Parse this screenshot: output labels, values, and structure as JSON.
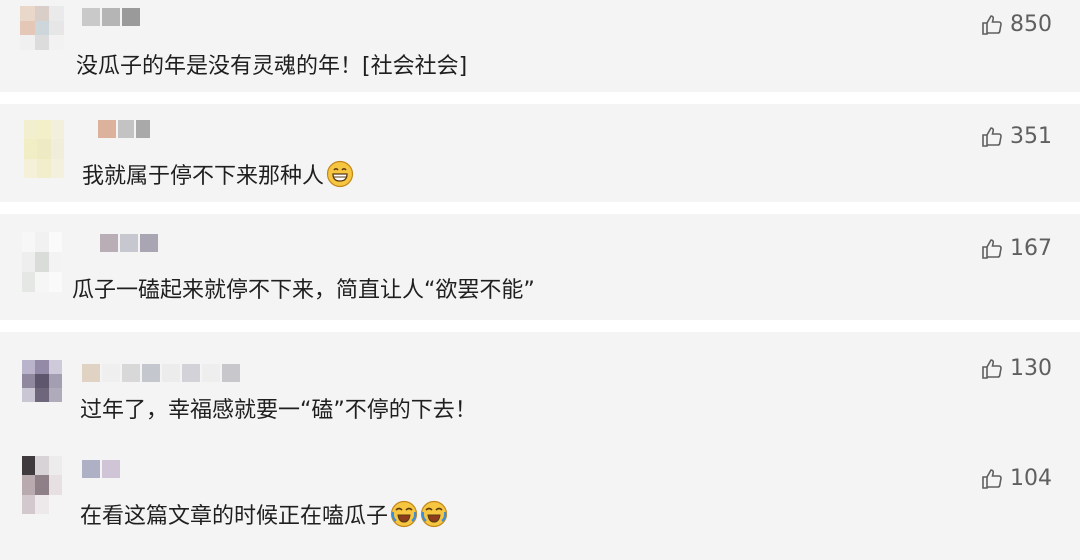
{
  "comments": [
    {
      "likes": "850",
      "text": "没瓜子的年是没有灵魂的年！[社会社会]",
      "emoji": ""
    },
    {
      "likes": "351",
      "text": "我就属于停不下来那种人",
      "emoji": "grin-emoji"
    },
    {
      "likes": "167",
      "text": "瓜子一磕起来就停不下来，简直让人“欲罢不能”",
      "emoji": ""
    },
    {
      "likes": "130",
      "text": "过年了，幸福感就要一“磕”不停的下去！",
      "emoji": ""
    },
    {
      "likes": "104",
      "text": "在看这篇文章的时候正在嗑瓜子",
      "emoji": "laugh-cry-emoji"
    }
  ],
  "icons": {
    "like": "thumbs-up-icon"
  },
  "colors": {
    "card_bg": "#f4f4f4",
    "text": "#1f1f1f",
    "meta": "#5f5f5f"
  }
}
